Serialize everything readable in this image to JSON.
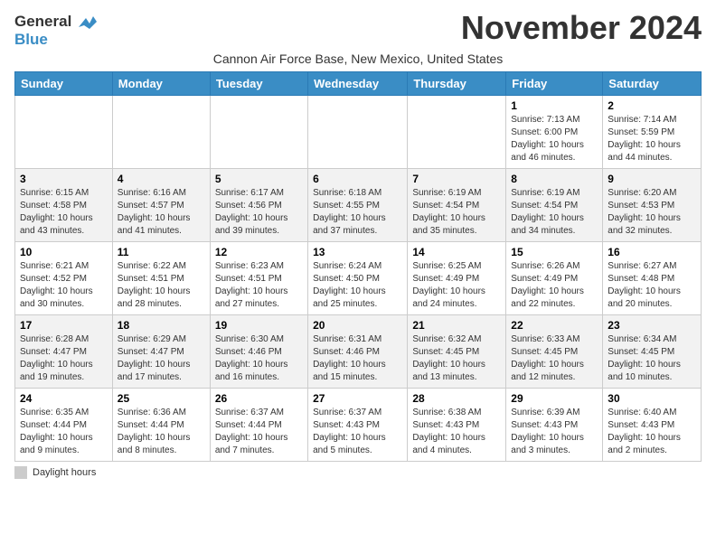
{
  "logo": {
    "line1": "General",
    "line2": "Blue"
  },
  "title": "November 2024",
  "subtitle": "Cannon Air Force Base, New Mexico, United States",
  "days_header": [
    "Sunday",
    "Monday",
    "Tuesday",
    "Wednesday",
    "Thursday",
    "Friday",
    "Saturday"
  ],
  "weeks": [
    [
      {
        "day": "",
        "info": ""
      },
      {
        "day": "",
        "info": ""
      },
      {
        "day": "",
        "info": ""
      },
      {
        "day": "",
        "info": ""
      },
      {
        "day": "",
        "info": ""
      },
      {
        "day": "1",
        "info": "Sunrise: 7:13 AM\nSunset: 6:00 PM\nDaylight: 10 hours and 46 minutes."
      },
      {
        "day": "2",
        "info": "Sunrise: 7:14 AM\nSunset: 5:59 PM\nDaylight: 10 hours and 44 minutes."
      }
    ],
    [
      {
        "day": "3",
        "info": "Sunrise: 6:15 AM\nSunset: 4:58 PM\nDaylight: 10 hours and 43 minutes."
      },
      {
        "day": "4",
        "info": "Sunrise: 6:16 AM\nSunset: 4:57 PM\nDaylight: 10 hours and 41 minutes."
      },
      {
        "day": "5",
        "info": "Sunrise: 6:17 AM\nSunset: 4:56 PM\nDaylight: 10 hours and 39 minutes."
      },
      {
        "day": "6",
        "info": "Sunrise: 6:18 AM\nSunset: 4:55 PM\nDaylight: 10 hours and 37 minutes."
      },
      {
        "day": "7",
        "info": "Sunrise: 6:19 AM\nSunset: 4:54 PM\nDaylight: 10 hours and 35 minutes."
      },
      {
        "day": "8",
        "info": "Sunrise: 6:19 AM\nSunset: 4:54 PM\nDaylight: 10 hours and 34 minutes."
      },
      {
        "day": "9",
        "info": "Sunrise: 6:20 AM\nSunset: 4:53 PM\nDaylight: 10 hours and 32 minutes."
      }
    ],
    [
      {
        "day": "10",
        "info": "Sunrise: 6:21 AM\nSunset: 4:52 PM\nDaylight: 10 hours and 30 minutes."
      },
      {
        "day": "11",
        "info": "Sunrise: 6:22 AM\nSunset: 4:51 PM\nDaylight: 10 hours and 28 minutes."
      },
      {
        "day": "12",
        "info": "Sunrise: 6:23 AM\nSunset: 4:51 PM\nDaylight: 10 hours and 27 minutes."
      },
      {
        "day": "13",
        "info": "Sunrise: 6:24 AM\nSunset: 4:50 PM\nDaylight: 10 hours and 25 minutes."
      },
      {
        "day": "14",
        "info": "Sunrise: 6:25 AM\nSunset: 4:49 PM\nDaylight: 10 hours and 24 minutes."
      },
      {
        "day": "15",
        "info": "Sunrise: 6:26 AM\nSunset: 4:49 PM\nDaylight: 10 hours and 22 minutes."
      },
      {
        "day": "16",
        "info": "Sunrise: 6:27 AM\nSunset: 4:48 PM\nDaylight: 10 hours and 20 minutes."
      }
    ],
    [
      {
        "day": "17",
        "info": "Sunrise: 6:28 AM\nSunset: 4:47 PM\nDaylight: 10 hours and 19 minutes."
      },
      {
        "day": "18",
        "info": "Sunrise: 6:29 AM\nSunset: 4:47 PM\nDaylight: 10 hours and 17 minutes."
      },
      {
        "day": "19",
        "info": "Sunrise: 6:30 AM\nSunset: 4:46 PM\nDaylight: 10 hours and 16 minutes."
      },
      {
        "day": "20",
        "info": "Sunrise: 6:31 AM\nSunset: 4:46 PM\nDaylight: 10 hours and 15 minutes."
      },
      {
        "day": "21",
        "info": "Sunrise: 6:32 AM\nSunset: 4:45 PM\nDaylight: 10 hours and 13 minutes."
      },
      {
        "day": "22",
        "info": "Sunrise: 6:33 AM\nSunset: 4:45 PM\nDaylight: 10 hours and 12 minutes."
      },
      {
        "day": "23",
        "info": "Sunrise: 6:34 AM\nSunset: 4:45 PM\nDaylight: 10 hours and 10 minutes."
      }
    ],
    [
      {
        "day": "24",
        "info": "Sunrise: 6:35 AM\nSunset: 4:44 PM\nDaylight: 10 hours and 9 minutes."
      },
      {
        "day": "25",
        "info": "Sunrise: 6:36 AM\nSunset: 4:44 PM\nDaylight: 10 hours and 8 minutes."
      },
      {
        "day": "26",
        "info": "Sunrise: 6:37 AM\nSunset: 4:44 PM\nDaylight: 10 hours and 7 minutes."
      },
      {
        "day": "27",
        "info": "Sunrise: 6:37 AM\nSunset: 4:43 PM\nDaylight: 10 hours and 5 minutes."
      },
      {
        "day": "28",
        "info": "Sunrise: 6:38 AM\nSunset: 4:43 PM\nDaylight: 10 hours and 4 minutes."
      },
      {
        "day": "29",
        "info": "Sunrise: 6:39 AM\nSunset: 4:43 PM\nDaylight: 10 hours and 3 minutes."
      },
      {
        "day": "30",
        "info": "Sunrise: 6:40 AM\nSunset: 4:43 PM\nDaylight: 10 hours and 2 minutes."
      }
    ]
  ],
  "footer": {
    "legend_label": "Daylight hours"
  }
}
